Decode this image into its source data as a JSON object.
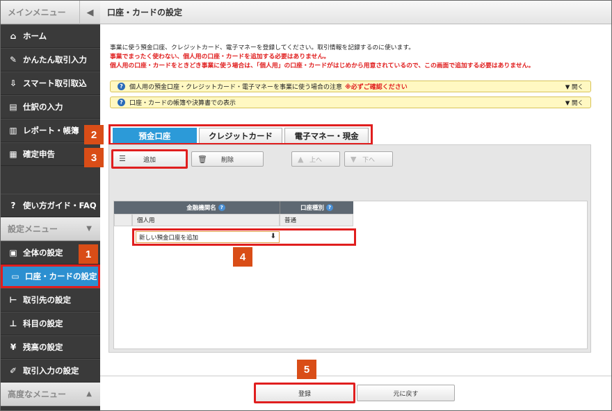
{
  "sidebar": {
    "main_menu": "メインメニュー",
    "collapse_icon": "chevron-left-icon",
    "items": [
      {
        "label": "ホーム",
        "icon": "home-icon"
      },
      {
        "label": "かんたん取引入力",
        "icon": "pencil-icon"
      },
      {
        "label": "スマート取引取込",
        "icon": "import-icon"
      },
      {
        "label": "仕訳の入力",
        "icon": "journal-icon"
      },
      {
        "label": "レポート・帳簿",
        "icon": "report-icon"
      },
      {
        "label": "確定申告",
        "icon": "tax-icon"
      }
    ],
    "guide": {
      "label": "使い方ガイド・FAQ",
      "icon": "help-icon"
    },
    "settings_menu": "設定メニュー",
    "settings_items": [
      {
        "label": "全体の設定",
        "icon": "settings-doc-icon"
      },
      {
        "label": "口座・カードの設定",
        "icon": "card-icon"
      },
      {
        "label": "取引先の設定",
        "icon": "partner-icon"
      },
      {
        "label": "科目の設定",
        "icon": "tree-icon"
      },
      {
        "label": "残高の設定",
        "icon": "yen-icon"
      },
      {
        "label": "取引入力の設定",
        "icon": "input-settings-icon"
      }
    ],
    "advanced_menu": "高度なメニュー"
  },
  "header": {
    "title": "口座・カードの設定"
  },
  "description": {
    "line1": "事業に使う預金口座、クレジットカード、電子マネーを登録してください。取引情報を記録するのに使います。",
    "line2": "事業でまったく使わない、個人用の口座・カードを追加する必要はありません。",
    "line3": "個人用の口座・カードをときどき事業に使う場合は、「個人用」の口座・カードがはじめから用意されているので、この画面で追加する必要はありません。"
  },
  "notices": [
    {
      "text": "個人用の預金口座・クレジットカード・電子マネーを事業に使う場合の注意",
      "warn": "※必ずご確認ください",
      "open": "▼ 開く"
    },
    {
      "text": "口座・カードの帳簿や決算書での表示",
      "warn": "",
      "open": "▼ 開く"
    }
  ],
  "tabs": [
    "預金口座",
    "クレジットカード",
    "電子マネー・現金"
  ],
  "toolbar": {
    "add": "追加",
    "delete": "削除",
    "up": "上へ",
    "down": "下へ"
  },
  "grid": {
    "col_bank": "金融機関名",
    "col_type": "口座種別",
    "row_name": "個人用",
    "row_type": "普通",
    "add_placeholder": "新しい預金口座を追加"
  },
  "footer": {
    "register": "登録",
    "back": "元に戻す"
  },
  "badges": [
    "1",
    "2",
    "3",
    "4",
    "5"
  ],
  "colors": {
    "accent": "#2c9ad8",
    "highlight": "#e01e1e",
    "badge": "#d94d17",
    "sidebar": "#3a3a3a"
  }
}
